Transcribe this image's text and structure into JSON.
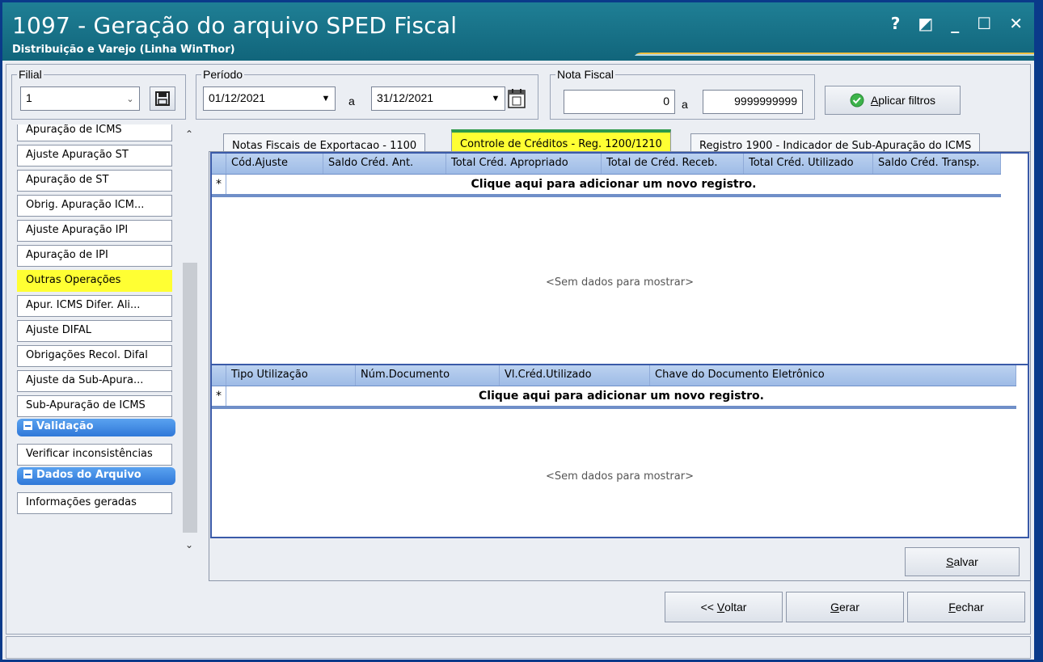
{
  "window": {
    "title": "1097 - Geração do arquivo SPED Fiscal",
    "subtitle": "Distribuição e Varejo (Linha WinThor)",
    "controls": {
      "help": "?",
      "restore": "◩",
      "minimize": "_",
      "maximize": "☐",
      "close": "✕"
    }
  },
  "filters": {
    "filial": {
      "label": "Filial",
      "value": "1"
    },
    "periodo": {
      "label": "Período",
      "from": "01/12/2021",
      "to": "31/12/2021",
      "separator": "a"
    },
    "nota_fiscal": {
      "label": "Nota Fiscal",
      "from": "0",
      "to": "9999999999",
      "separator": "a"
    },
    "apply_label_prefix": "",
    "apply_label_underlined": "A",
    "apply_label_rest": "plicar filtros"
  },
  "sidebar": {
    "items": [
      {
        "label": "Apuração de ICMS"
      },
      {
        "label": "Ajuste Apuração ST"
      },
      {
        "label": "Apuração de ST"
      },
      {
        "label": "Obrig. Apuração ICM..."
      },
      {
        "label": "Ajuste Apuração IPI"
      },
      {
        "label": "Apuração de IPI"
      },
      {
        "label": "Outras Operações",
        "highlighted": true
      },
      {
        "label": "Apur. ICMS Difer. Ali..."
      },
      {
        "label": "Ajuste DIFAL"
      },
      {
        "label": "Obrigações Recol. Difal"
      },
      {
        "label": "Ajuste da Sub-Apura..."
      },
      {
        "label": "Sub-Apuração de ICMS"
      }
    ],
    "groups": [
      {
        "label": "Validação",
        "items": [
          {
            "label": "Verificar inconsistências"
          }
        ]
      },
      {
        "label": "Dados do Arquivo",
        "items": [
          {
            "label": "Informações geradas"
          }
        ]
      }
    ]
  },
  "tabs": [
    {
      "label": "Notas Fiscais de Exportacao - 1100"
    },
    {
      "label": "Controle de Créditos - Reg. 1200/1210",
      "active": true
    },
    {
      "label": "Registro 1900 - Indicador de Sub-Apuração do ICMS"
    }
  ],
  "grid_top": {
    "columns": [
      "Cód.Ajuste",
      "Saldo Créd. Ant.",
      "Total Créd. Apropriado",
      "Total de Créd. Receb.",
      "Total Créd. Utilizado",
      "Saldo Créd. Transp."
    ],
    "new_row_text": "Clique aqui para adicionar um novo registro.",
    "new_row_marker": "*",
    "empty_text": "<Sem dados para mostrar>"
  },
  "grid_bottom": {
    "columns": [
      "Tipo Utilização",
      "Núm.Documento",
      "Vl.Créd.Utilizado",
      "Chave do Documento Eletrônico"
    ],
    "new_row_text": "Clique aqui para adicionar um novo registro.",
    "new_row_marker": "*",
    "empty_text": "<Sem dados para mostrar>"
  },
  "buttons": {
    "salvar": {
      "u": "S",
      "rest": "alvar"
    },
    "voltar": {
      "pre": "<< ",
      "u": "V",
      "rest": "oltar"
    },
    "gerar": {
      "u": "G",
      "rest": "erar"
    },
    "fechar": {
      "u": "F",
      "rest": "echar"
    }
  },
  "colors": {
    "titlebar": "#11657b",
    "highlight": "#ffff33",
    "group_header": "#2f78d8",
    "grid_border": "#3a5aa8"
  }
}
